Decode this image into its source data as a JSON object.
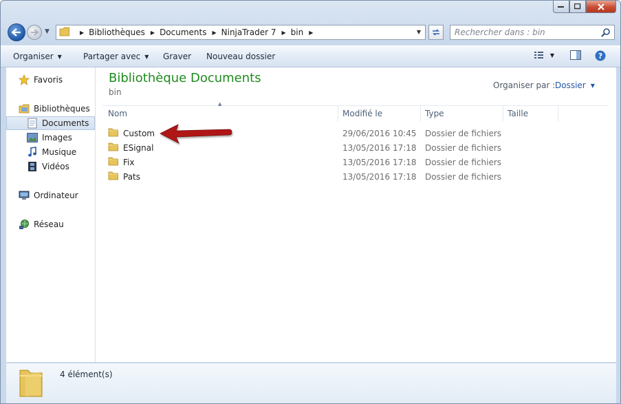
{
  "address": {
    "crumbs": [
      "Bibliothèques",
      "Documents",
      "NinjaTrader 7",
      "bin"
    ]
  },
  "search": {
    "placeholder": "Rechercher dans : bin"
  },
  "toolbar": {
    "organize": "Organiser",
    "share": "Partager avec",
    "burn": "Graver",
    "new_folder": "Nouveau dossier"
  },
  "navpane": {
    "favorites": "Favoris",
    "libraries": "Bibliothèques",
    "documents": "Documents",
    "images": "Images",
    "music": "Musique",
    "videos": "Vidéos",
    "computer": "Ordinateur",
    "network": "Réseau"
  },
  "content": {
    "title": "Bibliothèque Documents",
    "subtitle": "bin",
    "arrange_label": "Organiser par :",
    "arrange_value": "Dossier",
    "columns": {
      "name": "Nom",
      "modified": "Modifié le",
      "type": "Type",
      "size": "Taille"
    },
    "files": [
      {
        "name": "Custom",
        "modified": "29/06/2016 10:45",
        "type": "Dossier de fichiers"
      },
      {
        "name": "ESignal",
        "modified": "13/05/2016 17:18",
        "type": "Dossier de fichiers"
      },
      {
        "name": "Fix",
        "modified": "13/05/2016 17:18",
        "type": "Dossier de fichiers"
      },
      {
        "name": "Pats",
        "modified": "13/05/2016 17:18",
        "type": "Dossier de fichiers"
      }
    ]
  },
  "details": {
    "count": "4 élément(s)"
  },
  "colors": {
    "title_green": "#1f8a1f",
    "annotation_arrow": "#b01818",
    "selected_bg": "#dbe6f4"
  }
}
